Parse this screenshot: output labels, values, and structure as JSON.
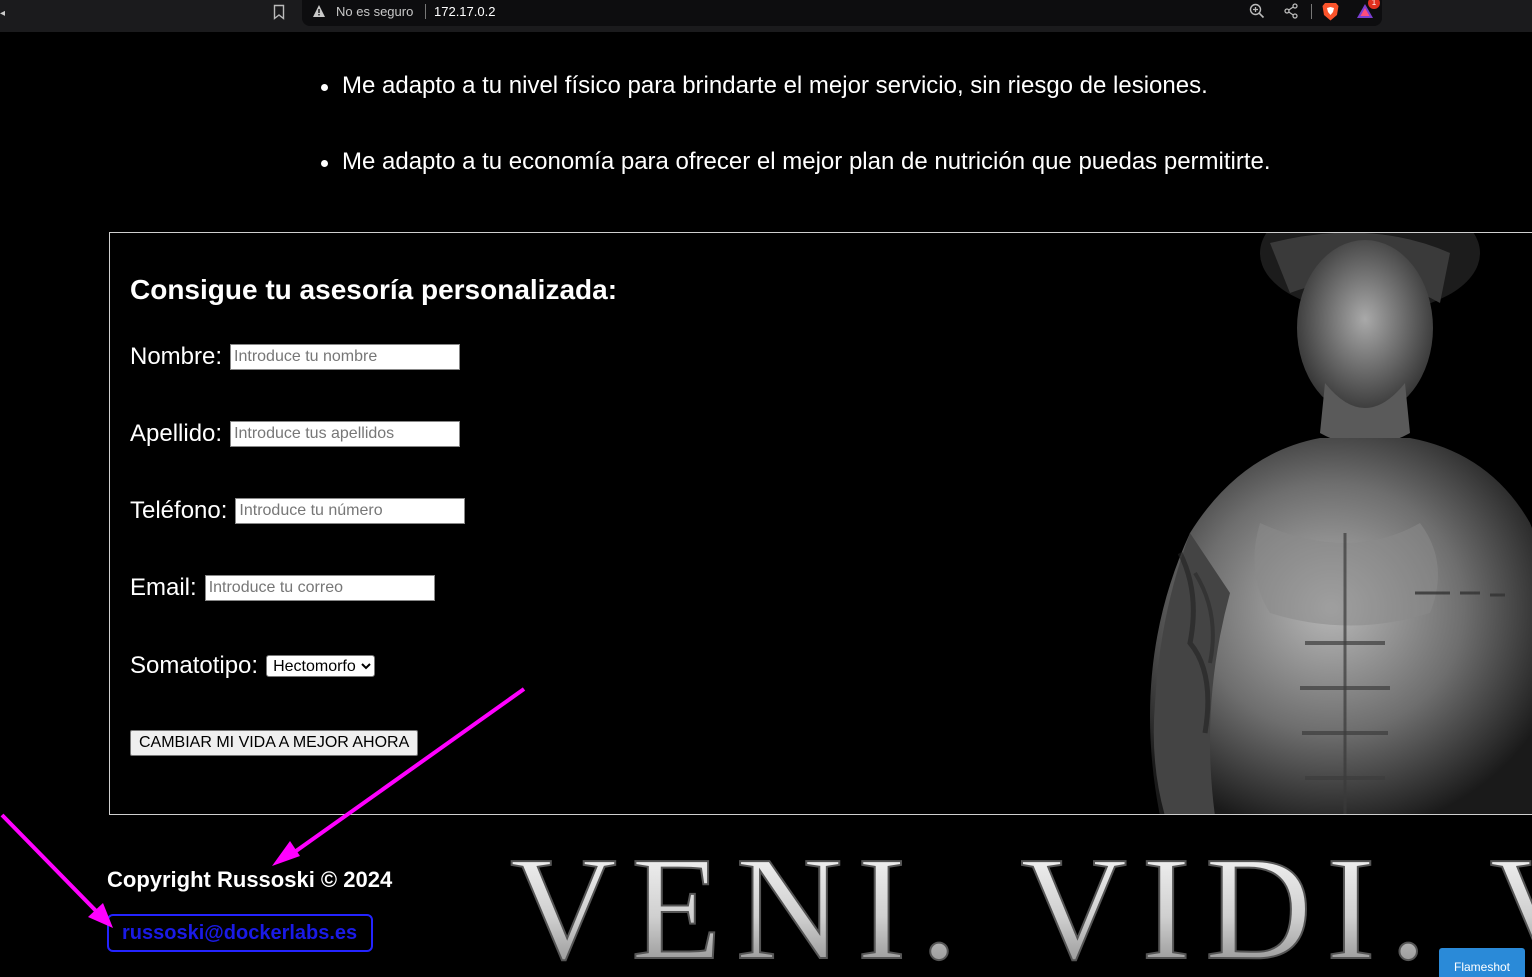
{
  "browser": {
    "security_label": "No es seguro",
    "url": "172.17.0.2",
    "rewards_badge": "1"
  },
  "benefits": [
    "Me adapto a tu nivel físico para brindarte el mejor servicio, sin riesgo de lesiones.",
    "Me adapto a tu economía para ofrecer el mejor plan de nutrición que puedas permitirte."
  ],
  "form": {
    "title": "Consigue tu asesoría personalizada:",
    "nombre": {
      "label": "Nombre:",
      "placeholder": "Introduce tu nombre",
      "value": ""
    },
    "apellido": {
      "label": "Apellido:",
      "placeholder": "Introduce tus apellidos",
      "value": ""
    },
    "telefono": {
      "label": "Teléfono:",
      "placeholder": "Introduce tu número",
      "value": ""
    },
    "email": {
      "label": "Email:",
      "placeholder": "Introduce tu correo",
      "value": ""
    },
    "somatotipo": {
      "label": "Somatotipo:",
      "selected": "Hectomorfo"
    },
    "submit_label": "CAMBIAR MI VIDA A MEJOR AHORA"
  },
  "footer": {
    "copyright": "Copyright Russoski © 2024",
    "email": "russoski@dockerlabs.es"
  },
  "banner": {
    "motto": "VENI. VIDI. VI"
  },
  "overlay": {
    "flameshot_label": "Flameshot",
    "arrow_color": "#ff00ff"
  },
  "colors": {
    "page_background": "#000000",
    "text": "#ffffff",
    "link_blue": "#1a1ae6",
    "flameshot_blue": "#2a8ad8"
  }
}
